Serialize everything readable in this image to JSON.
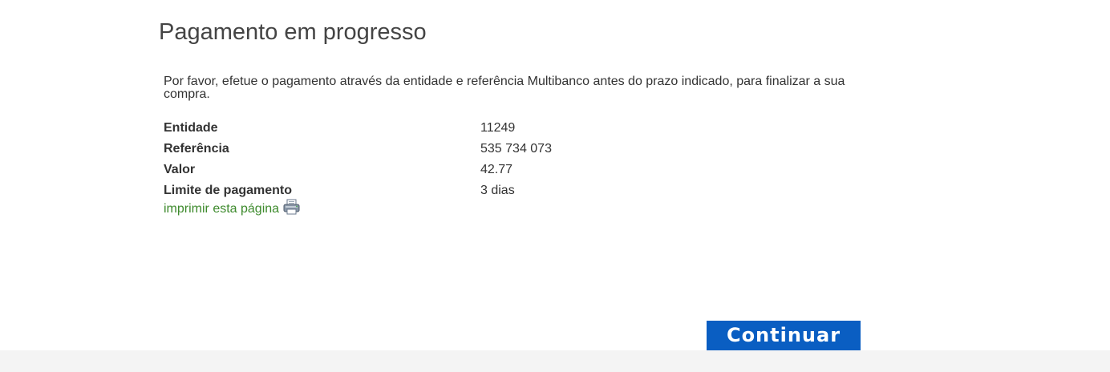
{
  "page": {
    "title": "Pagamento em progresso",
    "intro": "Por favor, efetue o pagamento através da entidade e referência Multibanco antes do prazo indicado, para finalizar a sua compra."
  },
  "payment": {
    "rows": [
      {
        "label": "Entidade",
        "value": "11249"
      },
      {
        "label": "Referência",
        "value": "535 734 073"
      },
      {
        "label": "Valor",
        "value": "42.77"
      },
      {
        "label": "Limite de pagamento",
        "value": "3 dias"
      }
    ]
  },
  "print": {
    "label": "imprimir esta página",
    "icon": "printer-icon"
  },
  "actions": {
    "continue_label": "Continuar"
  },
  "colors": {
    "link": "#3d8a2c",
    "button": "#0a5ec2",
    "footer": "#f4f4f4"
  }
}
